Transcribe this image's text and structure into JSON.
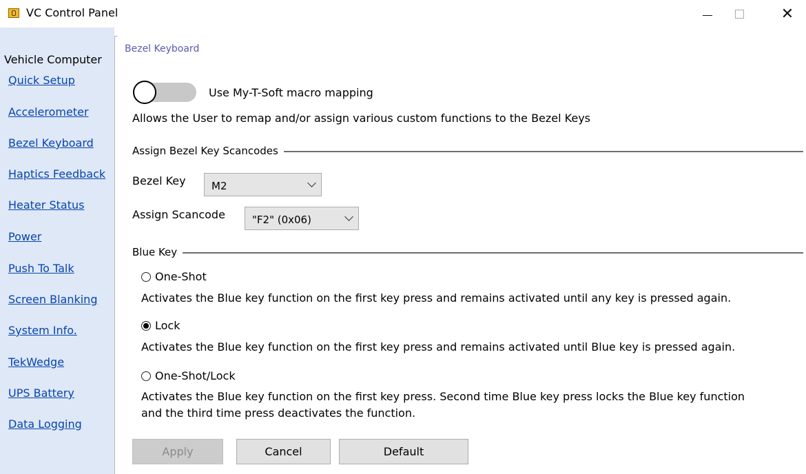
{
  "window": {
    "title": "VC Control Panel"
  },
  "sidebar": {
    "heading": "Vehicle Computer",
    "items": [
      {
        "label": "Quick Setup"
      },
      {
        "label": "Accelerometer"
      },
      {
        "label": "Bezel Keyboard"
      },
      {
        "label": "Haptics Feedback"
      },
      {
        "label": "Heater Status"
      },
      {
        "label": "Power"
      },
      {
        "label": "Push To Talk"
      },
      {
        "label": "Screen Blanking"
      },
      {
        "label": "System Info."
      },
      {
        "label": "TekWedge"
      },
      {
        "label": "UPS Battery"
      },
      {
        "label": "Data Logging"
      }
    ]
  },
  "main": {
    "title": "Bezel Keyboard",
    "toggle": {
      "label": "Use My-T-Soft macro mapping",
      "on": false
    },
    "description": "Allows the User to remap and/or assign various custom functions to the Bezel Keys",
    "scancodes": {
      "title": "Assign Bezel Key Scancodes",
      "bezel_key_label": "Bezel Key",
      "bezel_key_value": "M2",
      "scancode_label": "Assign Scancode",
      "scancode_value": "\"F2\" (0x06)"
    },
    "blue_key": {
      "title": "Blue Key",
      "options": [
        {
          "label": "One-Shot",
          "selected": false,
          "description": "Activates the Blue key function on the first key press and remains activated until any key is pressed again."
        },
        {
          "label": "Lock",
          "selected": true,
          "description": "Activates the Blue key function on the first key press and remains activated until Blue key is pressed again."
        },
        {
          "label": "One-Shot/Lock",
          "selected": false,
          "description_line1": "Activates the Blue key function on the first key press. Second time Blue key press locks the Blue key function",
          "description_line2": "and the third time press deactivates the function."
        }
      ]
    }
  },
  "buttons": {
    "apply": "Apply",
    "cancel": "Cancel",
    "default": "Default"
  },
  "colors": {
    "sidebar_bg": "#dfe8f7",
    "link": "#0645ad",
    "section_title": "#5a5ab4",
    "app_icon": "#f2b82a"
  }
}
